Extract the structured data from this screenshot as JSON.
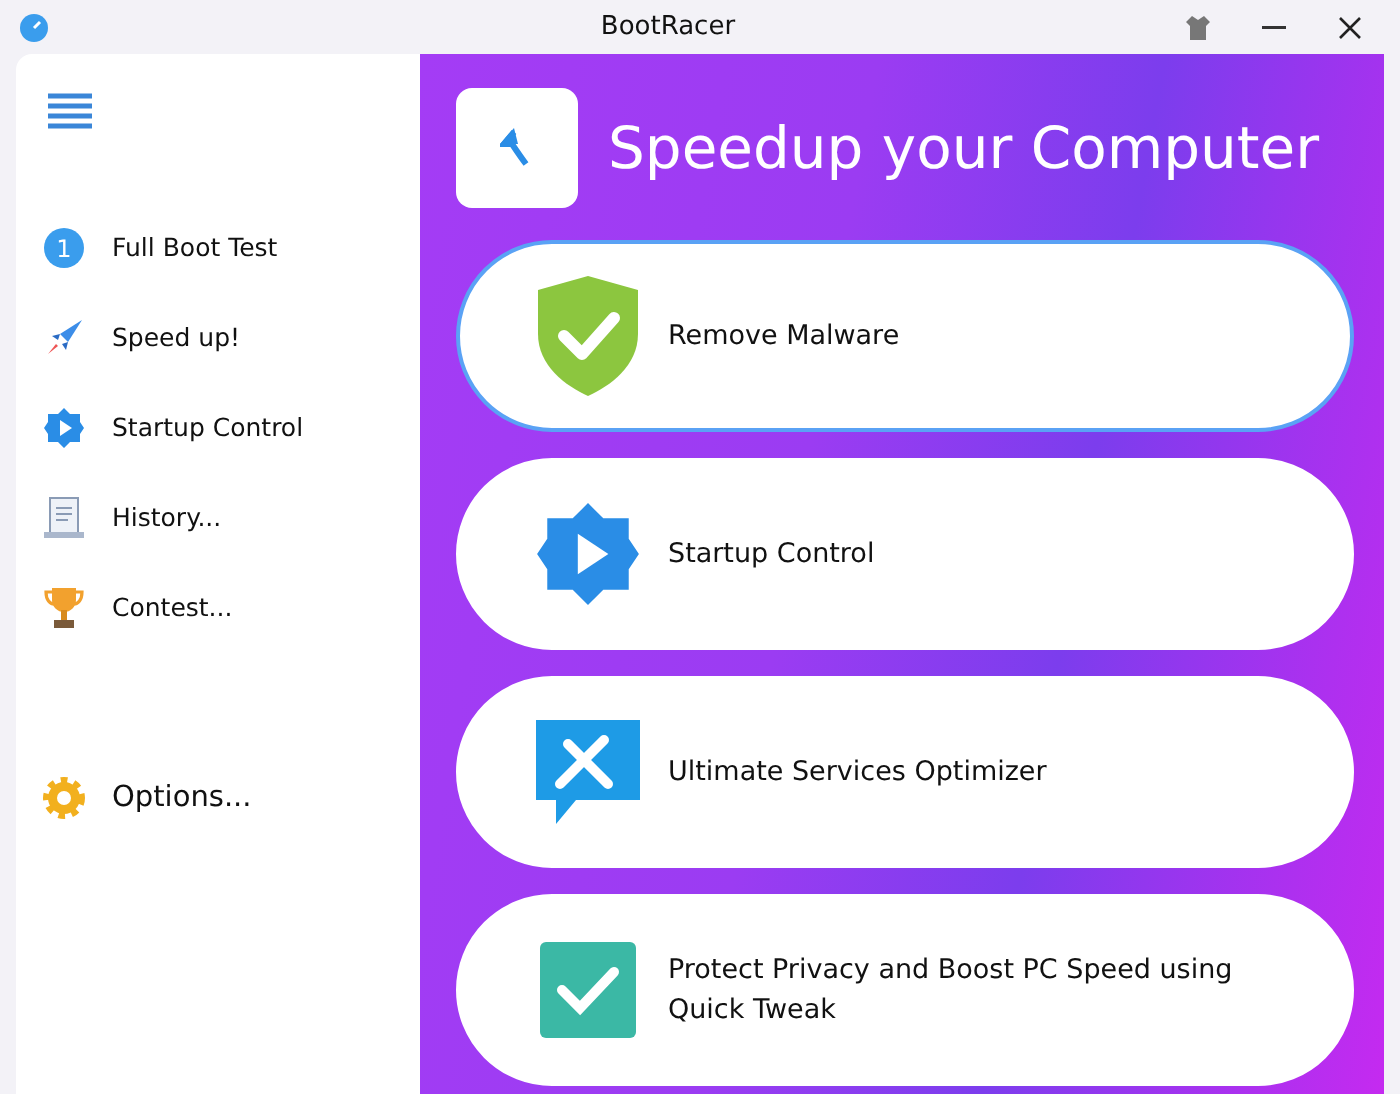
{
  "window": {
    "title": "BootRacer"
  },
  "sidebar": {
    "items": [
      {
        "label": "Full Boot Test",
        "kind": "number",
        "badge": "1"
      },
      {
        "label": "Speed up!",
        "kind": "rocket"
      },
      {
        "label": "Startup Control",
        "kind": "play"
      },
      {
        "label": "History...",
        "kind": "scroll"
      },
      {
        "label": "Contest...",
        "kind": "trophy"
      }
    ],
    "options": {
      "label": "Options..."
    }
  },
  "main": {
    "title": "Speedup your Computer",
    "cards": [
      {
        "label": "Remove Malware",
        "kind": "shield",
        "selected": true
      },
      {
        "label": "Startup Control",
        "kind": "gear",
        "selected": false
      },
      {
        "label": "Ultimate Services Optimizer",
        "kind": "tools",
        "selected": false
      },
      {
        "label": "Protect Privacy and Boost PC Speed using Quick Tweak",
        "kind": "check",
        "selected": false
      }
    ]
  }
}
